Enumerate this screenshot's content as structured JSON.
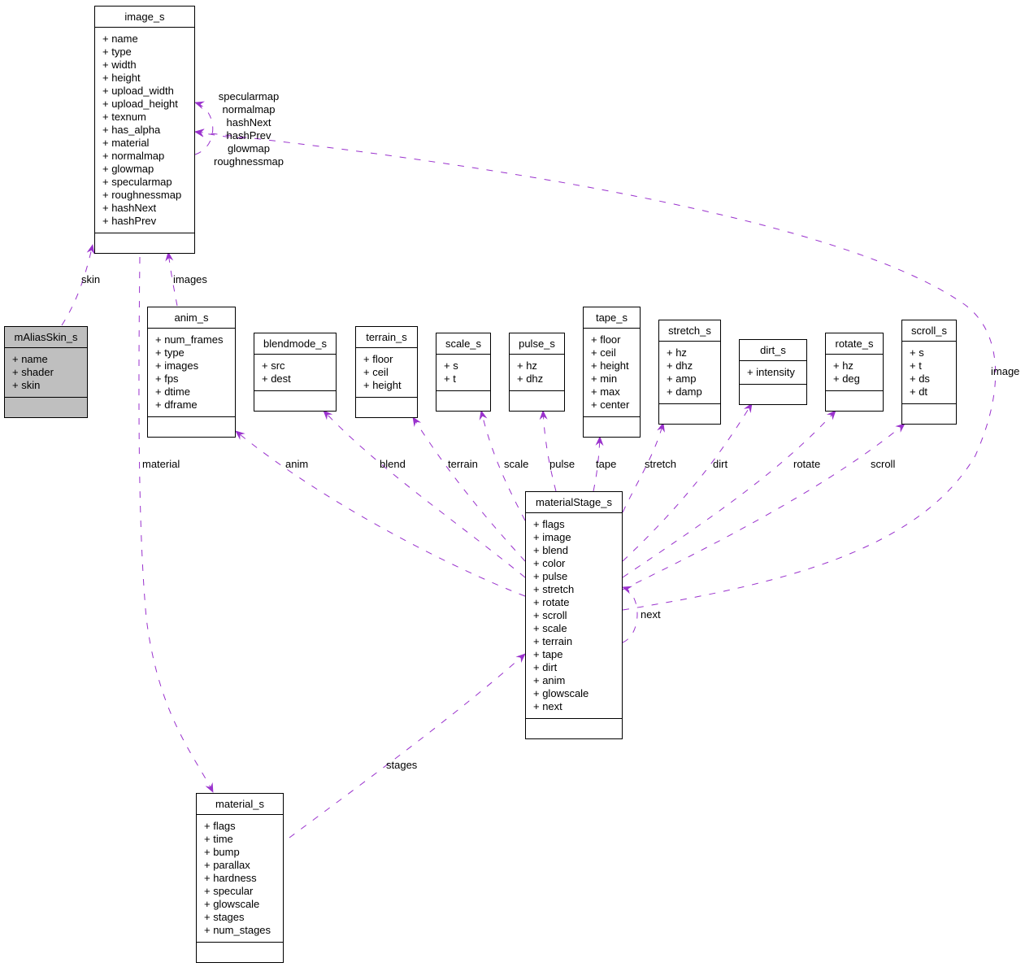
{
  "diagram": {
    "edge_color": "#9a32cd",
    "classes": {
      "image_s": {
        "title": "image_s",
        "fields": [
          "+ name",
          "+ type",
          "+ width",
          "+ height",
          "+ upload_width",
          "+ upload_height",
          "+ texnum",
          "+ has_alpha",
          "+ material",
          "+ normalmap",
          "+ glowmap",
          "+ specularmap",
          "+ roughnessmap",
          "+ hashNext",
          "+ hashPrev"
        ]
      },
      "mAliasSkin_s": {
        "title": "mAliasSkin_s",
        "fields": [
          "+ name",
          "+ shader",
          "+ skin"
        ],
        "highlighted": true
      },
      "anim_s": {
        "title": "anim_s",
        "fields": [
          "+ num_frames",
          "+ type",
          "+ images",
          "+ fps",
          "+ dtime",
          "+ dframe"
        ]
      },
      "blendmode_s": {
        "title": "blendmode_s",
        "fields": [
          "+ src",
          "+ dest"
        ]
      },
      "terrain_s": {
        "title": "terrain_s",
        "fields": [
          "+ floor",
          "+ ceil",
          "+ height"
        ]
      },
      "scale_s": {
        "title": "scale_s",
        "fields": [
          "+ s",
          "+ t"
        ]
      },
      "pulse_s": {
        "title": "pulse_s",
        "fields": [
          "+ hz",
          "+ dhz"
        ]
      },
      "tape_s": {
        "title": "tape_s",
        "fields": [
          "+ floor",
          "+ ceil",
          "+ height",
          "+ min",
          "+ max",
          "+ center"
        ]
      },
      "stretch_s": {
        "title": "stretch_s",
        "fields": [
          "+ hz",
          "+ dhz",
          "+ amp",
          "+ damp"
        ]
      },
      "dirt_s": {
        "title": "dirt_s",
        "fields": [
          "+ intensity"
        ]
      },
      "rotate_s": {
        "title": "rotate_s",
        "fields": [
          "+ hz",
          "+ deg"
        ]
      },
      "scroll_s": {
        "title": "scroll_s",
        "fields": [
          "+ s",
          "+ t",
          "+ ds",
          "+ dt"
        ]
      },
      "materialStage_s": {
        "title": "materialStage_s",
        "fields": [
          "+ flags",
          "+ image",
          "+ blend",
          "+ color",
          "+ pulse",
          "+ stretch",
          "+ rotate",
          "+ scroll",
          "+ scale",
          "+ terrain",
          "+ tape",
          "+ dirt",
          "+ anim",
          "+ glowscale",
          "+ next"
        ]
      },
      "material_s": {
        "title": "material_s",
        "fields": [
          "+ flags",
          "+ time",
          "+ bump",
          "+ parallax",
          "+ hardness",
          "+ specular",
          "+ glowscale",
          "+ stages",
          "+ num_stages"
        ]
      }
    },
    "edge_labels": {
      "self_image": [
        "specularmap",
        "normalmap",
        "hashNext",
        "hashPrev",
        "glowmap",
        "roughnessmap"
      ],
      "skin": "skin",
      "images": "images",
      "material": "material",
      "anim": "anim",
      "blend": "blend",
      "terrain": "terrain",
      "scale": "scale",
      "pulse": "pulse",
      "tape": "tape",
      "stretch": "stretch",
      "dirt": "dirt",
      "rotate": "rotate",
      "scroll": "scroll",
      "image": "image",
      "next": "next",
      "stages": "stages"
    },
    "edges": [
      {
        "from": "image_s",
        "to": "image_s",
        "label": "self_image"
      },
      {
        "from": "mAliasSkin_s",
        "to": "image_s",
        "label": "skin"
      },
      {
        "from": "anim_s",
        "to": "image_s",
        "label": "images"
      },
      {
        "from": "image_s",
        "to": "material_s",
        "label": "material"
      },
      {
        "from": "materialStage_s",
        "to": "anim_s",
        "label": "anim"
      },
      {
        "from": "materialStage_s",
        "to": "blendmode_s",
        "label": "blend"
      },
      {
        "from": "materialStage_s",
        "to": "terrain_s",
        "label": "terrain"
      },
      {
        "from": "materialStage_s",
        "to": "scale_s",
        "label": "scale"
      },
      {
        "from": "materialStage_s",
        "to": "pulse_s",
        "label": "pulse"
      },
      {
        "from": "materialStage_s",
        "to": "tape_s",
        "label": "tape"
      },
      {
        "from": "materialStage_s",
        "to": "stretch_s",
        "label": "stretch"
      },
      {
        "from": "materialStage_s",
        "to": "dirt_s",
        "label": "dirt"
      },
      {
        "from": "materialStage_s",
        "to": "rotate_s",
        "label": "rotate"
      },
      {
        "from": "materialStage_s",
        "to": "scroll_s",
        "label": "scroll"
      },
      {
        "from": "materialStage_s",
        "to": "image_s",
        "label": "image"
      },
      {
        "from": "materialStage_s",
        "to": "materialStage_s",
        "label": "next"
      },
      {
        "from": "material_s",
        "to": "materialStage_s",
        "label": "stages"
      }
    ]
  }
}
